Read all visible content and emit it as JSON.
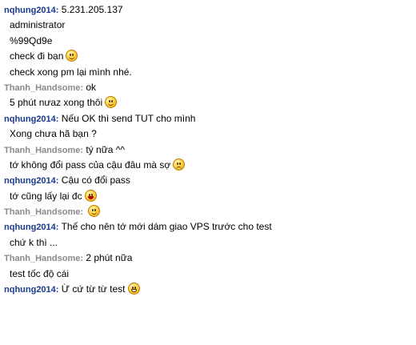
{
  "colors": {
    "user1_name": "#1a3a8f",
    "user2_name": "#8a8a8a",
    "text": "#000000"
  },
  "users": {
    "u1": "nqhung2014:",
    "u2": "Thanh_Handsome:"
  },
  "messages": [
    {
      "kind": "head",
      "user": "u1",
      "text": "5.231.205.137"
    },
    {
      "kind": "cont",
      "text": "administrator"
    },
    {
      "kind": "cont",
      "text": "%99Qd9e"
    },
    {
      "kind": "cont",
      "text": "check đi bạn",
      "emoticon": "smile-icon"
    },
    {
      "kind": "cont",
      "text": "check xong pm lại mình nhé."
    },
    {
      "kind": "head",
      "user": "u2",
      "text": "ok"
    },
    {
      "kind": "cont",
      "text": "5 phút nưaz xong thôi",
      "emoticon": "smile-icon"
    },
    {
      "kind": "head",
      "user": "u1",
      "text": "Nếu OK thì send TUT cho mình"
    },
    {
      "kind": "cont",
      "text": "Xong chưa hã bạn ?"
    },
    {
      "kind": "head",
      "user": "u2",
      "text": "tý nữa ^^"
    },
    {
      "kind": "cont",
      "text": "tớ không đổi pass của cậu đâu mà sợ",
      "emoticon": "worried-icon"
    },
    {
      "kind": "head",
      "user": "u1",
      "text": "Cậu có đổi pass"
    },
    {
      "kind": "cont",
      "text": "tớ cũng lấy lại đc",
      "emoticon": "laugh-icon"
    },
    {
      "kind": "head",
      "user": "u2",
      "text": "",
      "emoticon": "smile-icon"
    },
    {
      "kind": "head",
      "user": "u1",
      "text": "Thế cho nên tớ mới dám giao VPS trước cho test"
    },
    {
      "kind": "cont",
      "text": "chứ k thì ..."
    },
    {
      "kind": "head",
      "user": "u2",
      "text": "2 phút nữa"
    },
    {
      "kind": "cont",
      "text": "test tốc độ cái"
    },
    {
      "kind": "head",
      "user": "u1",
      "text": "Ừ cứ từ từ test",
      "emoticon": "big-grin-icon"
    }
  ]
}
